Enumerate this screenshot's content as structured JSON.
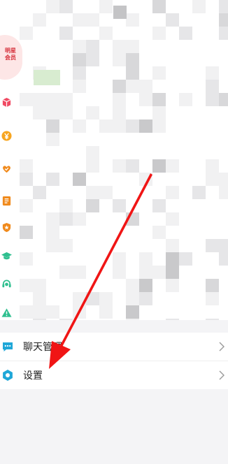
{
  "profile": {
    "vip_badge_text": "明星会员"
  },
  "side_icons": [
    {
      "name": "gift-box-icon",
      "color": "#f04a63"
    },
    {
      "name": "yuan-coin-icon",
      "color": "#f7a51f"
    },
    {
      "name": "heart-hands-icon",
      "color": "#f08a1c"
    },
    {
      "name": "document-list-icon",
      "color": "#f08a1c"
    },
    {
      "name": "shield-star-icon",
      "color": "#f08a1c"
    },
    {
      "name": "graduation-cap-icon",
      "color": "#2fbf8f"
    },
    {
      "name": "headset-service-icon",
      "color": "#2fbf8f"
    },
    {
      "name": "warning-triangle-icon",
      "color": "#2fbf8f"
    }
  ],
  "menu": {
    "chat_management_label": "聊天管理",
    "settings_label": "设置",
    "chat_icon": "chat-bubble-icon",
    "settings_icon": "gear-icon",
    "icon_color": "#1fa7d8"
  },
  "annotation": {
    "arrow_color": "#f01515",
    "pointing_to": "设置"
  }
}
